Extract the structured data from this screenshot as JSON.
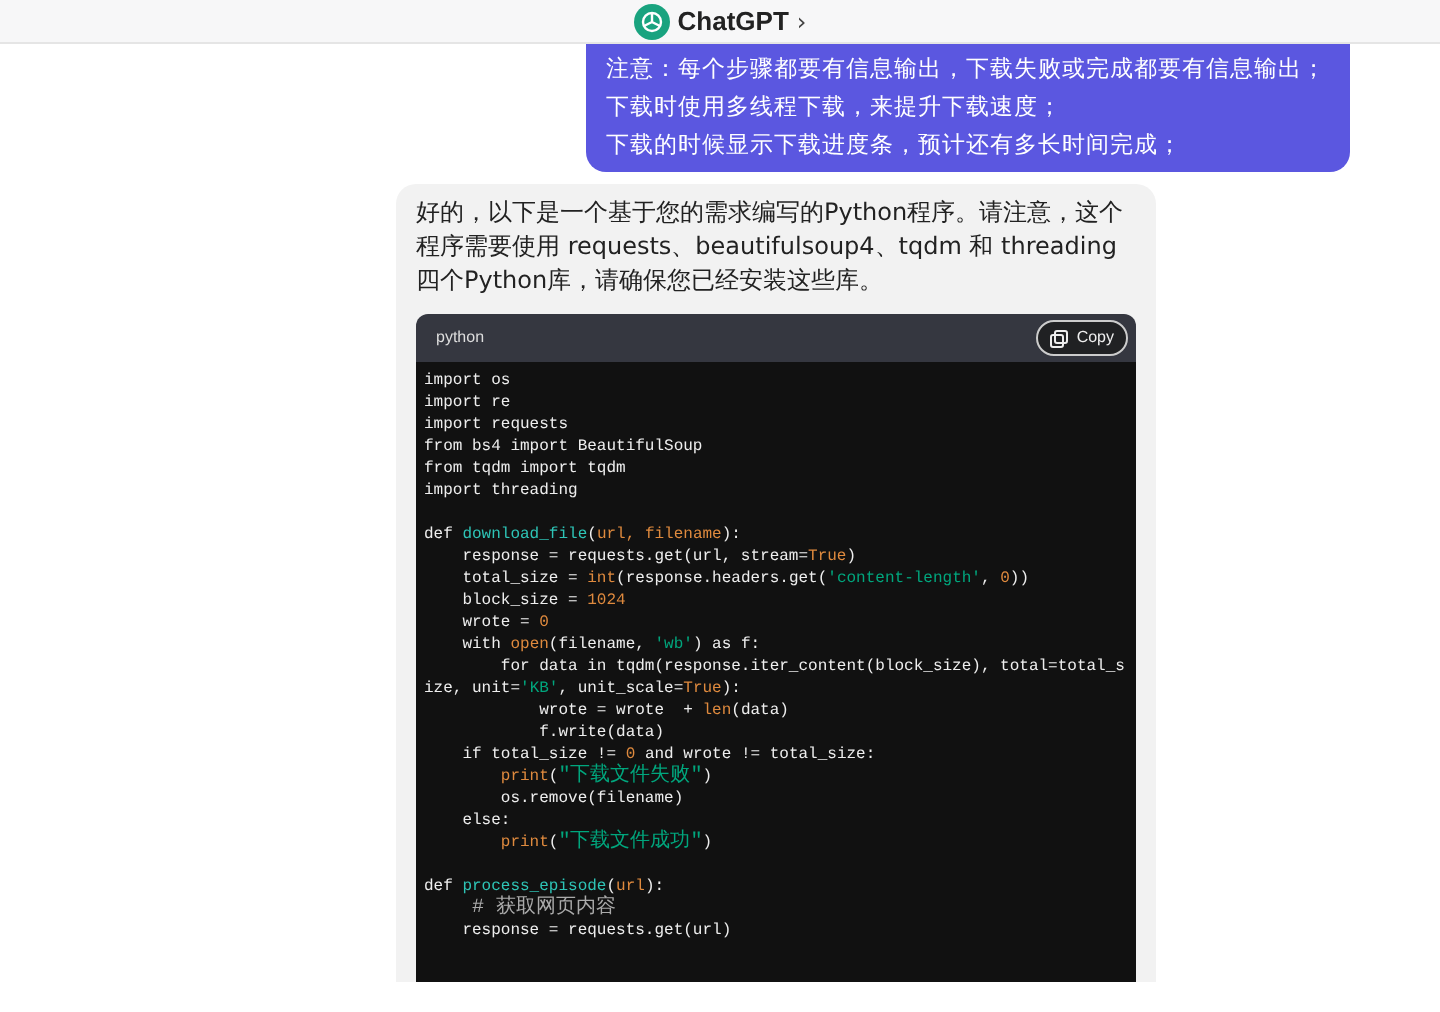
{
  "header": {
    "title": "ChatGPT",
    "chevron": "›"
  },
  "user_message": {
    "lines": [
      "注意：每个步骤都要有信息输出，下载失败或完成都要有信息输出；",
      "下载时使用多线程下载，来提升下载速度；",
      "下载的时候显示下载进度条，预计还有多长时间完成；"
    ]
  },
  "assistant_message": {
    "text": "好的，以下是一个基于您的需求编写的Python程序。请注意，这个程序需要使用 requests、beautifulsoup4、tqdm 和 threading 四个Python库，请确保您已经安装这些库。",
    "code_block": {
      "language": "python",
      "copy_label": "Copy",
      "lines": [
        {
          "tokens": [
            {
              "kind": "plain",
              "text": "import os"
            }
          ]
        },
        {
          "tokens": [
            {
              "kind": "plain",
              "text": "import re"
            }
          ]
        },
        {
          "tokens": [
            {
              "kind": "plain",
              "text": "import requests"
            }
          ]
        },
        {
          "tokens": [
            {
              "kind": "plain",
              "text": "from bs4 import BeautifulSoup"
            }
          ]
        },
        {
          "tokens": [
            {
              "kind": "plain",
              "text": "from tqdm import tqdm"
            }
          ]
        },
        {
          "tokens": [
            {
              "kind": "plain",
              "text": "import threading"
            }
          ]
        },
        {
          "space_before": true,
          "tokens": [
            {
              "kind": "plain",
              "text": "def "
            },
            {
              "kind": "fn",
              "text": "download_file"
            },
            {
              "kind": "plain",
              "text": "("
            },
            {
              "kind": "orange",
              "text": "url, filename"
            },
            {
              "kind": "plain",
              "text": "):"
            }
          ]
        },
        {
          "tokens": [
            {
              "kind": "plain",
              "text": "    response = requests.get(url, stream="
            },
            {
              "kind": "orange",
              "text": "True"
            },
            {
              "kind": "plain",
              "text": ")"
            }
          ]
        },
        {
          "tokens": [
            {
              "kind": "plain",
              "text": "    total_size = "
            },
            {
              "kind": "orange",
              "text": "int"
            },
            {
              "kind": "plain",
              "text": "(response.headers.get("
            },
            {
              "kind": "str",
              "text": "'content-length'"
            },
            {
              "kind": "plain",
              "text": ", "
            },
            {
              "kind": "orange",
              "text": "0"
            },
            {
              "kind": "plain",
              "text": "))"
            }
          ]
        },
        {
          "tokens": [
            {
              "kind": "plain",
              "text": "    block_size = "
            },
            {
              "kind": "orange",
              "text": "1024"
            }
          ]
        },
        {
          "tokens": [
            {
              "kind": "plain",
              "text": "    wrote = "
            },
            {
              "kind": "orange",
              "text": "0"
            }
          ]
        },
        {
          "tokens": [
            {
              "kind": "plain",
              "text": "    with "
            },
            {
              "kind": "orange",
              "text": "open"
            },
            {
              "kind": "plain",
              "text": "(filename, "
            },
            {
              "kind": "str",
              "text": "'wb'"
            },
            {
              "kind": "plain",
              "text": ") as f:"
            }
          ]
        },
        {
          "tokens": [
            {
              "kind": "plain",
              "text": "        for data in tqdm(response.iter_content(block_size), total=total_s"
            }
          ]
        },
        {
          "tokens": [
            {
              "kind": "plain",
              "text": "ize, unit="
            },
            {
              "kind": "str",
              "text": "'KB'"
            },
            {
              "kind": "plain",
              "text": ", unit_scale="
            },
            {
              "kind": "orange",
              "text": "True"
            },
            {
              "kind": "plain",
              "text": "):"
            }
          ]
        },
        {
          "tokens": [
            {
              "kind": "plain",
              "text": "            wrote = wrote  + "
            },
            {
              "kind": "orange",
              "text": "len"
            },
            {
              "kind": "plain",
              "text": "(data)"
            }
          ]
        },
        {
          "tokens": [
            {
              "kind": "plain",
              "text": "            f.write(data)"
            }
          ]
        },
        {
          "tokens": [
            {
              "kind": "plain",
              "text": "    if total_size != "
            },
            {
              "kind": "orange",
              "text": "0"
            },
            {
              "kind": "plain",
              "text": " and wrote != total_size:"
            }
          ]
        },
        {
          "tokens": [
            {
              "kind": "orange",
              "text": "        print"
            },
            {
              "kind": "plain",
              "text": "("
            },
            {
              "kind": "cjkstr",
              "text": "\"下载文件失败\""
            },
            {
              "kind": "plain",
              "text": ")"
            }
          ]
        },
        {
          "tokens": [
            {
              "kind": "plain",
              "text": "        os.remove(filename)"
            }
          ]
        },
        {
          "tokens": [
            {
              "kind": "plain",
              "text": "    else:"
            }
          ]
        },
        {
          "tokens": [
            {
              "kind": "orange",
              "text": "        print"
            },
            {
              "kind": "plain",
              "text": "("
            },
            {
              "kind": "cjkstr",
              "text": "\"下载文件成功\""
            },
            {
              "kind": "plain",
              "text": ")"
            }
          ]
        },
        {
          "space_before": true,
          "tokens": [
            {
              "kind": "plain",
              "text": "def "
            },
            {
              "kind": "fn",
              "text": "process_episode"
            },
            {
              "kind": "plain",
              "text": "("
            },
            {
              "kind": "orange",
              "text": "url"
            },
            {
              "kind": "plain",
              "text": "):"
            }
          ]
        },
        {
          "tokens": [
            {
              "kind": "comment",
              "text": "    # 获取网页内容"
            }
          ]
        },
        {
          "tokens": [
            {
              "kind": "plain",
              "text": "    response = requests.get(url)"
            }
          ]
        }
      ]
    }
  }
}
